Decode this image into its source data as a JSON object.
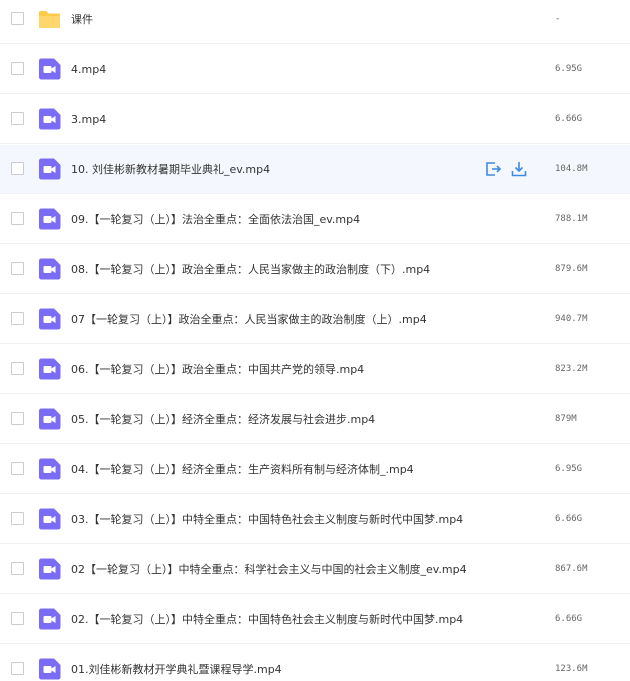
{
  "colors": {
    "accent": "#3f8ae6",
    "video_icon": "#7b6cf6",
    "folder_icon": "#ffc94a",
    "hover_row": "#f4f7fd"
  },
  "files": [
    {
      "icon": "folder-icon",
      "name": "课件",
      "size": "-"
    },
    {
      "icon": "video-file-icon",
      "name": "4.mp4",
      "size": "6.95G"
    },
    {
      "icon": "video-file-icon",
      "name": "3.mp4",
      "size": "6.66G"
    },
    {
      "icon": "video-file-icon",
      "name": "10. 刘佳彬新教材暑期毕业典礼_ev.mp4",
      "size": "104.8M",
      "hovered": true
    },
    {
      "icon": "video-file-icon",
      "name": "09.【一轮复习（上）】法治全重点：全面依法治国_ev.mp4",
      "size": "788.1M"
    },
    {
      "icon": "video-file-icon",
      "name": "08.【一轮复习（上）】政治全重点：人民当家做主的政治制度（下）.mp4",
      "size": "879.6M"
    },
    {
      "icon": "video-file-icon",
      "name": "07【一轮复习（上）】政治全重点：人民当家做主的政治制度（上）.mp4",
      "size": "940.7M"
    },
    {
      "icon": "video-file-icon",
      "name": "06.【一轮复习（上）】政治全重点：中国共产党的领导.mp4",
      "size": "823.2M"
    },
    {
      "icon": "video-file-icon",
      "name": "05.【一轮复习（上）】经济全重点：经济发展与社会进步.mp4",
      "size": "879M"
    },
    {
      "icon": "video-file-icon",
      "name": "04.【一轮复习（上）】经济全重点：生产资料所有制与经济体制_.mp4",
      "size": "6.95G"
    },
    {
      "icon": "video-file-icon",
      "name": "03.【一轮复习（上）】中特全重点：中国特色社会主义制度与新时代中国梦.mp4",
      "size": "6.66G"
    },
    {
      "icon": "video-file-icon",
      "name": "02【一轮复习（上）】中特全重点：科学社会主义与中国的社会主义制度_ev.mp4",
      "size": "867.6M"
    },
    {
      "icon": "video-file-icon",
      "name": "02.【一轮复习（上）】中特全重点：中国特色社会主义制度与新时代中国梦.mp4",
      "size": "6.66G"
    },
    {
      "icon": "video-file-icon",
      "name": "01.刘佳彬新教材开学典礼暨课程导学.mp4",
      "size": "123.6M"
    }
  ],
  "row_actions": [
    {
      "icon": "share-icon"
    },
    {
      "icon": "download-icon"
    }
  ]
}
